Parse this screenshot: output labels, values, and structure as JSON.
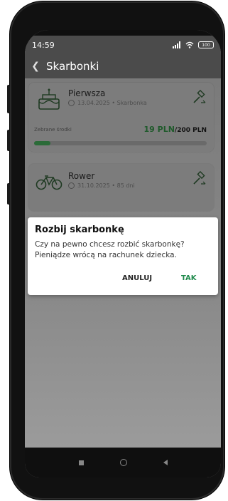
{
  "status": {
    "time": "14:59",
    "battery": "100"
  },
  "header": {
    "title": "Skarbonki"
  },
  "cards": [
    {
      "name": "Pierwsza",
      "subtitle": "13.04.2025 • Skarbonka",
      "collected_label": "Zebrane środki",
      "current": "19 PLN",
      "goal": "/200 PLN",
      "progress": 0.095
    },
    {
      "name": "Rower",
      "subtitle": "31.10.2025 • 85 dni"
    }
  ],
  "dialog": {
    "title": "Rozbij skarbonkę",
    "message": "Czy na pewno chcesz rozbić skarbonkę? Pieniądze wrócą na rachunek dziecka.",
    "cancel": "ANULUJ",
    "confirm": "TAK"
  },
  "colors": {
    "accent": "#1f8a4c"
  }
}
